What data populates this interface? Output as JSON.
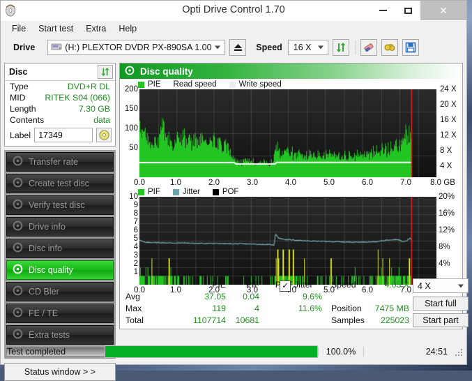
{
  "window": {
    "title": "Opti Drive Control 1.70",
    "app_icon": "disc-icon",
    "minimize": "–",
    "maximize": "□",
    "close": "✕"
  },
  "menu": {
    "items": [
      "File",
      "Start test",
      "Extra",
      "Help"
    ]
  },
  "toolbar": {
    "drive_label": "Drive",
    "drive_value": "(H:)  PLEXTOR DVDR  PX-890SA 1.00",
    "eject_icon": "eject-icon",
    "speed_label": "Speed",
    "speed_value": "16 X",
    "refresh_icon": "refresh-arrows-icon",
    "erase_icon": "eraser-icon",
    "tools_icon": "plug-icon",
    "save_icon": "floppy-save-icon"
  },
  "disc": {
    "header": "Disc",
    "refresh_icon": "refresh-arrows-icon",
    "rows": [
      {
        "key": "Type",
        "value": "DVD+R DL"
      },
      {
        "key": "MID",
        "value": "RITEK S04 (066)"
      },
      {
        "key": "Length",
        "value": "7.30 GB"
      },
      {
        "key": "Contents",
        "value": "data"
      }
    ],
    "label_key": "Label",
    "label_value": "17349",
    "label_icon": "cd-disc-icon"
  },
  "nav": {
    "items": [
      {
        "label": "Transfer rate",
        "icon": "disc-icon",
        "active": false
      },
      {
        "label": "Create test disc",
        "icon": "disc-icon",
        "active": false
      },
      {
        "label": "Verify test disc",
        "icon": "disc-icon",
        "active": false
      },
      {
        "label": "Drive info",
        "icon": "drive-icon",
        "active": false
      },
      {
        "label": "Disc info",
        "icon": "disc-icon",
        "active": false
      },
      {
        "label": "Disc quality",
        "icon": "disc-icon",
        "active": true
      },
      {
        "label": "CD Bler",
        "icon": "disc-icon",
        "active": false
      },
      {
        "label": "FE / TE",
        "icon": "disc-icon",
        "active": false
      },
      {
        "label": "Extra tests",
        "icon": "disc-icon",
        "active": false
      }
    ],
    "status_window": "Status window > >"
  },
  "panel": {
    "title": "Disc quality",
    "title_icon": "disc-quality-icon"
  },
  "chart_data": [
    {
      "type": "area",
      "name": "pie-chart",
      "title": "",
      "legend": [
        {
          "label": "PIE",
          "color": "#22c522"
        },
        {
          "label": "Read speed",
          "color": "#ffffff"
        },
        {
          "label": "Write speed",
          "color": "#f2f2f2"
        }
      ],
      "xlabel": "GB",
      "ylabel": "",
      "xlim": [
        0.0,
        8.0
      ],
      "ylim": [
        0,
        200
      ],
      "y2lim": [
        0,
        24
      ],
      "xticks": [
        "0.0",
        "1.0",
        "2.0",
        "3.0",
        "4.0",
        "5.0",
        "6.0",
        "7.0",
        "8.0 GB"
      ],
      "yticks": [
        "200",
        "150",
        "100",
        "50"
      ],
      "y2ticks": [
        "24 X",
        "20 X",
        "16 X",
        "12 X",
        "8 X",
        "4 X"
      ],
      "grid": true,
      "series": [
        {
          "name": "PIE",
          "color": "#22c522",
          "x": [
            0.0,
            0.1,
            0.2,
            0.3,
            0.4,
            0.5,
            0.6,
            0.7,
            0.8,
            0.9,
            1.0,
            1.1,
            1.2,
            1.3,
            1.4,
            1.5,
            1.6,
            1.7,
            1.8,
            1.9,
            2.0,
            2.1,
            2.2,
            2.3,
            2.4,
            2.5,
            2.6,
            2.7,
            2.8,
            2.9,
            3.0,
            3.1,
            3.2,
            3.3,
            3.4,
            3.5,
            3.6,
            3.65,
            3.75,
            3.85,
            3.95,
            4.05,
            4.15,
            4.25,
            4.35,
            4.45,
            4.55,
            4.65,
            4.75,
            4.85,
            4.95,
            5.1,
            5.25,
            5.4,
            5.55,
            5.7,
            5.85,
            6.0,
            6.15,
            6.3,
            6.45,
            6.6,
            6.75,
            6.9,
            7.0,
            7.1,
            7.2,
            7.28,
            7.33
          ],
          "y": [
            118,
            92,
            85,
            80,
            74,
            82,
            110,
            95,
            78,
            72,
            90,
            82,
            86,
            88,
            84,
            86,
            82,
            80,
            78,
            84,
            80,
            78,
            74,
            70,
            68,
            40,
            36,
            34,
            35,
            36,
            34,
            35,
            36,
            34,
            33,
            34,
            33,
            72,
            60,
            55,
            58,
            54,
            56,
            50,
            52,
            48,
            50,
            52,
            50,
            48,
            50,
            52,
            50,
            48,
            50,
            48,
            52,
            50,
            54,
            56,
            58,
            62,
            66,
            72,
            80,
            88,
            96,
            104,
            62
          ]
        },
        {
          "name": "Read speed",
          "color": "#ffffff",
          "x": [
            0.0,
            2.55,
            2.6,
            3.65,
            3.7,
            7.33
          ],
          "y_speed": [
            4.0,
            4.0,
            3.6,
            3.6,
            4.05,
            4.05
          ]
        }
      ],
      "pointer_line": {
        "x": 7.33,
        "color": "#e81c1c"
      }
    },
    {
      "type": "area",
      "name": "pif-chart",
      "legend": [
        {
          "label": "PIF",
          "color": "#22c522"
        },
        {
          "label": "Jitter",
          "color": "#7aacb4"
        },
        {
          "label": "POF",
          "color": "#000000"
        }
      ],
      "xlabel": "GB",
      "xlim": [
        0.0,
        8.0
      ],
      "ylim": [
        0,
        10
      ],
      "y2lim": [
        0,
        20
      ],
      "xticks": [
        "0.0",
        "1.0",
        "2.0",
        "3.0",
        "4.0",
        "5.0",
        "6.0",
        "7.0",
        "8.0 GB"
      ],
      "yticks": [
        "10",
        "9",
        "8",
        "7",
        "6",
        "5",
        "4",
        "3",
        "2",
        "1"
      ],
      "y2ticks": [
        "20%",
        "16%",
        "12%",
        "8%",
        "4%"
      ],
      "grid": true,
      "series": [
        {
          "name": "Jitter",
          "color": "#7aacb4",
          "x": [
            0.0,
            0.15,
            0.4,
            0.8,
            1.2,
            1.6,
            2.0,
            2.4,
            2.8,
            3.2,
            3.55,
            3.63,
            3.66,
            3.75,
            3.9,
            4.1,
            4.4,
            4.8,
            5.2,
            5.6,
            6.0,
            6.4,
            6.7,
            6.95,
            7.1,
            7.2,
            7.28,
            7.33
          ],
          "y_pct": [
            10.2,
            9.6,
            9.6,
            9.5,
            9.5,
            9.4,
            9.4,
            9.3,
            9.3,
            9.2,
            9.1,
            9.0,
            11.6,
            10.6,
            10.3,
            10.2,
            10.0,
            9.9,
            9.8,
            9.7,
            9.7,
            9.8,
            10.2,
            10.3,
            9.8,
            10.0,
            10.6,
            10.2
          ]
        },
        {
          "name": "PIF",
          "color": "#22c522",
          "note": "sparse spikes mostly 1-2, dense cluster 3.65-4.4 up to 4, isolated 3 at 0.78 and 5.15 and 7.25"
        }
      ],
      "pointer_line": {
        "x": 7.33,
        "color": "#e81c1c"
      }
    }
  ],
  "stats": {
    "columns": [
      "PIE",
      "PIF",
      "POF",
      "Jitter"
    ],
    "jitter_checked": true,
    "rows": [
      {
        "label": "Avg",
        "pie": "37.05",
        "pif": "0.04",
        "pof": "",
        "jitter": "9.6%"
      },
      {
        "label": "Max",
        "pie": "119",
        "pif": "4",
        "pof": "",
        "jitter": "11.6%"
      },
      {
        "label": "Total",
        "pie": "1107714",
        "pif": "10681",
        "pof": "",
        "jitter": ""
      }
    ],
    "speed_label": "Speed",
    "speed_value": "4.05 X",
    "position_label": "Position",
    "position_value": "7475 MB",
    "samples_label": "Samples",
    "samples_value": "225023",
    "test_speed": "4 X",
    "start_full": "Start full",
    "start_part": "Start part"
  },
  "statusbar": {
    "text": "Test completed",
    "progress_pct": "100.0%",
    "progress_value": 100,
    "elapsed": "24:51"
  }
}
